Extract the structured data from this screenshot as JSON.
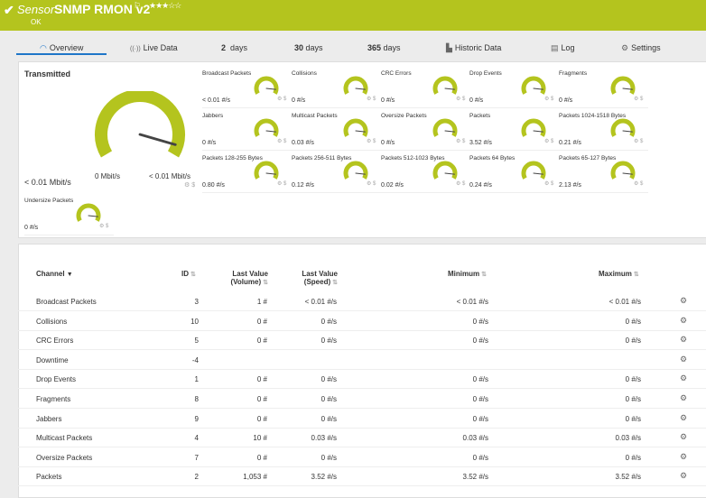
{
  "header": {
    "check_icon": "checkmark-icon",
    "sensor_label": "Sensor",
    "sensor_name": "SNMP RMON v2",
    "flag_icon": "flag-icon",
    "stars": "★★★☆☆",
    "status": "OK",
    "bg_color": "#b4c41e"
  },
  "tabs": [
    {
      "icon": "overview-icon",
      "glyph": "◠",
      "label": "Overview"
    },
    {
      "icon": "live-data-icon",
      "glyph": "((·))",
      "label": "Live Data"
    },
    {
      "label_num": "2",
      "label": "days"
    },
    {
      "label_num": "30",
      "label": "days"
    },
    {
      "label_num": "365",
      "label": "days"
    },
    {
      "icon": "chart-icon",
      "glyph": "▙",
      "label": "Historic Data"
    },
    {
      "icon": "log-icon",
      "glyph": "▤",
      "label": "Log"
    },
    {
      "icon": "gear-icon",
      "glyph": "⚙",
      "label": "Settings"
    }
  ],
  "overview": {
    "big_gauge": {
      "title": "Transmitted",
      "value": "< 0.01 Mbit/s",
      "min_label": "0 Mbit/s",
      "max_label": "< 0.01 Mbit/s",
      "level": 0.94,
      "color": "#b4c41e"
    },
    "gauges": [
      {
        "label": "Broadcast Packets",
        "value": "< 0.01 #/s",
        "level": 0.9
      },
      {
        "label": "Collisions",
        "value": "0 #/s",
        "level": 0.9
      },
      {
        "label": "CRC Errors",
        "value": "0 #/s",
        "level": 0.9
      },
      {
        "label": "Drop Events",
        "value": "0 #/s",
        "level": 0.9
      },
      {
        "label": "Fragments",
        "value": "0 #/s",
        "level": 0.9
      },
      {
        "label": "Jabbers",
        "value": "0 #/s",
        "level": 0.9
      },
      {
        "label": "Multicast Packets",
        "value": "0.03 #/s",
        "level": 0.9
      },
      {
        "label": "Oversize Packets",
        "value": "0 #/s",
        "level": 0.9
      },
      {
        "label": "Packets",
        "value": "3.52 #/s",
        "level": 0.9
      },
      {
        "label": "Packets 1024-1518 Bytes",
        "value": "0.21 #/s",
        "level": 0.9
      },
      {
        "label": "Packets 128-255 Bytes",
        "value": "0.80 #/s",
        "level": 0.9
      },
      {
        "label": "Packets 256-511 Bytes",
        "value": "0.12 #/s",
        "level": 0.9
      },
      {
        "label": "Packets 512-1023 Bytes",
        "value": "0.02 #/s",
        "level": 0.9
      },
      {
        "label": "Packets 64 Bytes",
        "value": "0.24 #/s",
        "level": 0.9
      },
      {
        "label": "Packets 65-127 Bytes",
        "value": "2.13 #/s",
        "level": 0.9
      },
      {
        "label": "Undersize Packets",
        "value": "0 #/s",
        "level": 0.9
      }
    ]
  },
  "table": {
    "headers": {
      "channel": "Channel",
      "id": "ID",
      "last_volume_1": "Last Value",
      "last_volume_2": "(Volume)",
      "last_speed_1": "Last Value",
      "last_speed_2": "(Speed)",
      "minimum": "Minimum",
      "maximum": "Maximum"
    },
    "rows": [
      {
        "channel": "Broadcast Packets",
        "id": "3",
        "volume": "1 #",
        "speed": "< 0.01 #/s",
        "min": "< 0.01 #/s",
        "max": "< 0.01 #/s"
      },
      {
        "channel": "Collisions",
        "id": "10",
        "volume": "0 #",
        "speed": "0 #/s",
        "min": "0 #/s",
        "max": "0 #/s"
      },
      {
        "channel": "CRC Errors",
        "id": "5",
        "volume": "0 #",
        "speed": "0 #/s",
        "min": "0 #/s",
        "max": "0 #/s"
      },
      {
        "channel": "Downtime",
        "id": "-4",
        "volume": "",
        "speed": "",
        "min": "",
        "max": ""
      },
      {
        "channel": "Drop Events",
        "id": "1",
        "volume": "0 #",
        "speed": "0 #/s",
        "min": "0 #/s",
        "max": "0 #/s"
      },
      {
        "channel": "Fragments",
        "id": "8",
        "volume": "0 #",
        "speed": "0 #/s",
        "min": "0 #/s",
        "max": "0 #/s"
      },
      {
        "channel": "Jabbers",
        "id": "9",
        "volume": "0 #",
        "speed": "0 #/s",
        "min": "0 #/s",
        "max": "0 #/s"
      },
      {
        "channel": "Multicast Packets",
        "id": "4",
        "volume": "10 #",
        "speed": "0.03 #/s",
        "min": "0.03 #/s",
        "max": "0.03 #/s"
      },
      {
        "channel": "Oversize Packets",
        "id": "7",
        "volume": "0 #",
        "speed": "0 #/s",
        "min": "0 #/s",
        "max": "0 #/s"
      },
      {
        "channel": "Packets",
        "id": "2",
        "volume": "1,053 #",
        "speed": "3.52 #/s",
        "min": "3.52 #/s",
        "max": "3.52 #/s"
      }
    ]
  }
}
